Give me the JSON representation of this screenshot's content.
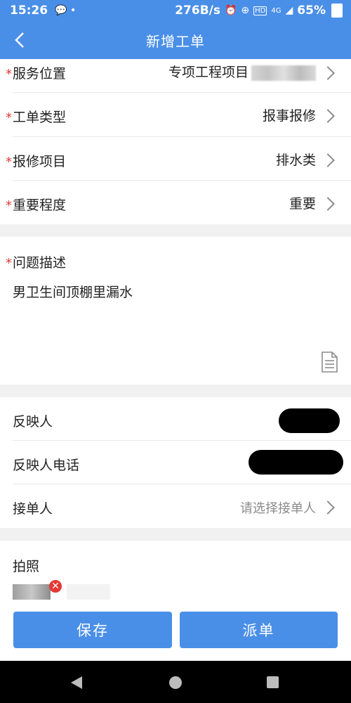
{
  "status_bar": {
    "time": "15:26",
    "notif_icons": "💬 •",
    "net_speed": "276B/s",
    "network": "4G",
    "battery": "65%"
  },
  "header": {
    "title": "新增工单"
  },
  "required_mark": "*",
  "fields": {
    "service_location": {
      "label": "服务位置",
      "value": "专项工程项目"
    },
    "order_type": {
      "label": "工单类型",
      "value": "报事报修"
    },
    "repair_item": {
      "label": "报修项目",
      "value": "排水类"
    },
    "importance": {
      "label": "重要程度",
      "value": "重要"
    }
  },
  "description": {
    "label": "问题描述",
    "text": "男卫生间顶棚里漏水"
  },
  "reporter": {
    "name_label": "反映人",
    "phone_label": "反映人电话"
  },
  "assignee": {
    "label": "接单人",
    "placeholder": "请选择接单人"
  },
  "photos": {
    "label": "拍照"
  },
  "buttons": {
    "save": "保存",
    "dispatch": "派单"
  },
  "colors": {
    "primary": "#4a8fe7",
    "required": "#e03a3a",
    "placeholder": "#8a8a8a",
    "section_gap": "#f1f1f1"
  }
}
